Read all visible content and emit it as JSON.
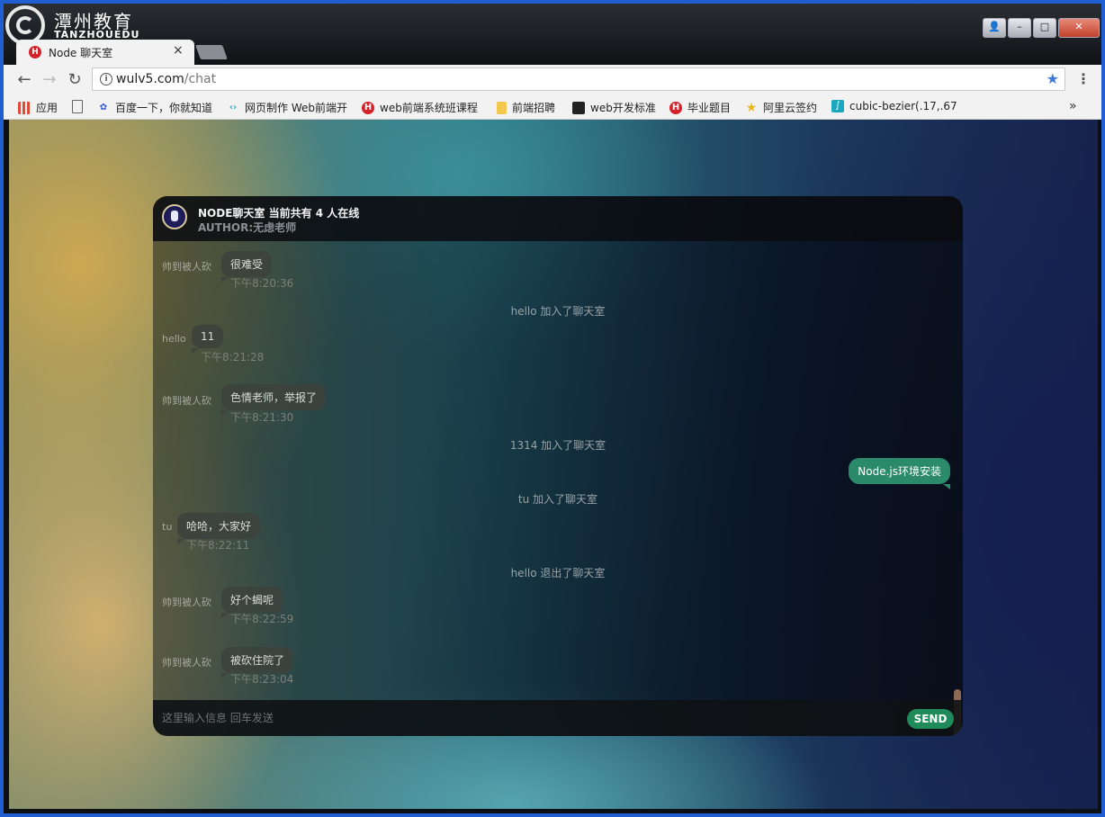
{
  "brand": {
    "name_cn": "潭州教育",
    "name_en": "TANZHOUEDU"
  },
  "tab": {
    "favicon": "H",
    "title": "Node 聊天室",
    "close": "×"
  },
  "window_buttons": {
    "user": "👤",
    "minimize": "–",
    "maximize": "□",
    "close": "✕"
  },
  "toolbar": {
    "back": "←",
    "forward": "→",
    "reload": "↻",
    "url_host": "wulv5.com",
    "url_path": "/chat",
    "bookmark_star": "★",
    "menu": "⋮"
  },
  "bookmarks": [
    {
      "label": "应用",
      "icon": "apps-grid-icon"
    },
    {
      "label": "",
      "icon": "page-icon"
    },
    {
      "label": "百度一下，你就知道",
      "icon": "baidu-icon"
    },
    {
      "label": "网页制作 Web前端开",
      "icon": "code-icon"
    },
    {
      "label": "web前端系统班课程",
      "icon": "h-logo-icon"
    },
    {
      "label": "前端招聘",
      "icon": "folder-icon"
    },
    {
      "label": "web开发标准",
      "icon": "bookmark-icon"
    },
    {
      "label": "毕业题目",
      "icon": "h-logo-icon"
    },
    {
      "label": "阿里云签约",
      "icon": "star-icon"
    },
    {
      "label": "cubic-bezier(.17,.67",
      "icon": "curve-icon"
    }
  ],
  "bookmarks_more": "»",
  "chat": {
    "title": "NODE聊天室  当前共有 4 人在线",
    "author": "AUTHOR:无虑老师",
    "messages": [
      {
        "kind": "msg",
        "sender": "帅到被人砍",
        "text": "很难受",
        "time": "下午8:20:36"
      },
      {
        "kind": "sys",
        "text": "hello 加入了聊天室"
      },
      {
        "kind": "msg",
        "sender": "hello",
        "text": "11",
        "time": "下午8:21:28"
      },
      {
        "kind": "msg",
        "sender": "帅到被人砍",
        "text": "色情老师，举报了",
        "time": "下午8:21:30"
      },
      {
        "kind": "sys",
        "text": "1314 加入了聊天室"
      },
      {
        "kind": "mine",
        "text": "Node.js环境安装"
      },
      {
        "kind": "sys",
        "text": "tu 加入了聊天室"
      },
      {
        "kind": "msg",
        "sender": "tu",
        "text": "哈哈，大家好",
        "time": "下午8:22:11"
      },
      {
        "kind": "sys",
        "text": "hello 退出了聊天室"
      },
      {
        "kind": "msg",
        "sender": "帅到被人砍",
        "text": "好个蝎呢",
        "time": "下午8:22:59"
      },
      {
        "kind": "msg",
        "sender": "帅到被人砍",
        "text": "被砍住院了",
        "time": "下午8:23:04"
      }
    ],
    "input_placeholder": "这里输入信息 回车发送",
    "input_value": "",
    "send_label": "SEND"
  },
  "colors": {
    "send": "#1f8a5a",
    "mine_bubble": "#2a8a6a",
    "favicon_red": "#d6202a"
  }
}
